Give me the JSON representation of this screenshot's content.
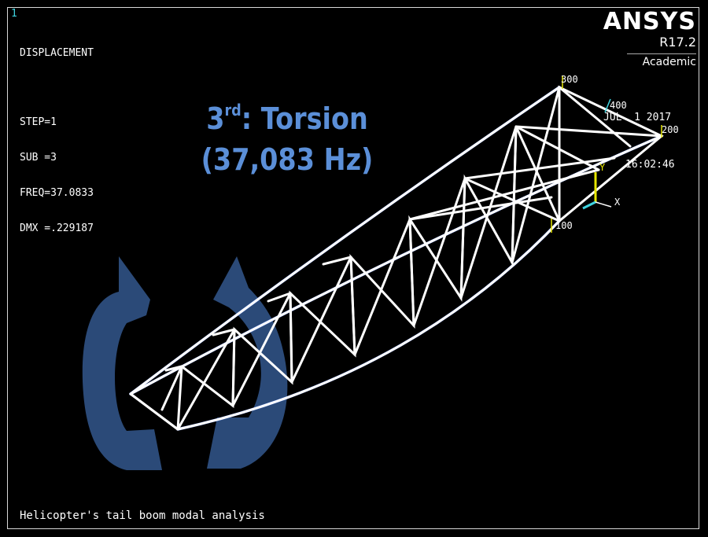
{
  "window_number": "1",
  "result": {
    "title": "DISPLACEMENT",
    "step": "STEP=1",
    "sub": "SUB =3",
    "freq": "FREQ=37.0833",
    "dmx": "DMX =.229187"
  },
  "logo": {
    "brand": "ANSYS",
    "version": "R17.2",
    "edition": "Academic"
  },
  "datetime": {
    "date": "JUL  1 2017",
    "time": "16:02:46"
  },
  "headline": {
    "mode_num": "3",
    "mode_sup": "rd",
    "mode_name": ": Torsion",
    "freq": "(37,083 Hz)"
  },
  "caption": "Helicopter's tail boom modal analysis",
  "node_labels": [
    "300",
    "400",
    "200",
    "100"
  ],
  "axis_labels": {
    "x": "X",
    "y": "Y"
  },
  "colors": {
    "background": "#000000",
    "text": "#ffffff",
    "headline": "#5b8fd8",
    "rotation_arrow": "#2b4a78",
    "window_number": "#3fd4e0",
    "axis_y": "#e6e600",
    "axis_x": "#3fd4e0"
  },
  "icons": [
    "rotation-arrow-icon",
    "axis-triad-icon"
  ]
}
